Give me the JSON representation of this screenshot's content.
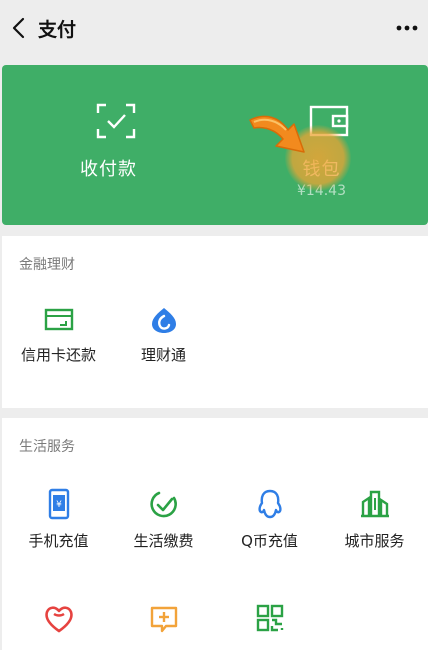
{
  "header": {
    "title": "支付"
  },
  "banner": {
    "collect_label": "收付款",
    "wallet_label": "钱包",
    "wallet_balance": "¥14.43"
  },
  "finance": {
    "section_title": "金融理财",
    "items": [
      {
        "label": "信用卡还款"
      },
      {
        "label": "理财通"
      }
    ]
  },
  "life": {
    "section_title": "生活服务",
    "items": [
      {
        "label": "手机充值"
      },
      {
        "label": "生活缴费"
      },
      {
        "label": "Q币充值"
      },
      {
        "label": "城市服务"
      }
    ]
  },
  "colors": {
    "banner_green": "#3fae67",
    "icon_green": "#2ba245",
    "icon_blue": "#2f7ee6",
    "icon_red": "#e64340",
    "icon_orange": "#f2a33a",
    "highlight_orange": "#eca534"
  }
}
